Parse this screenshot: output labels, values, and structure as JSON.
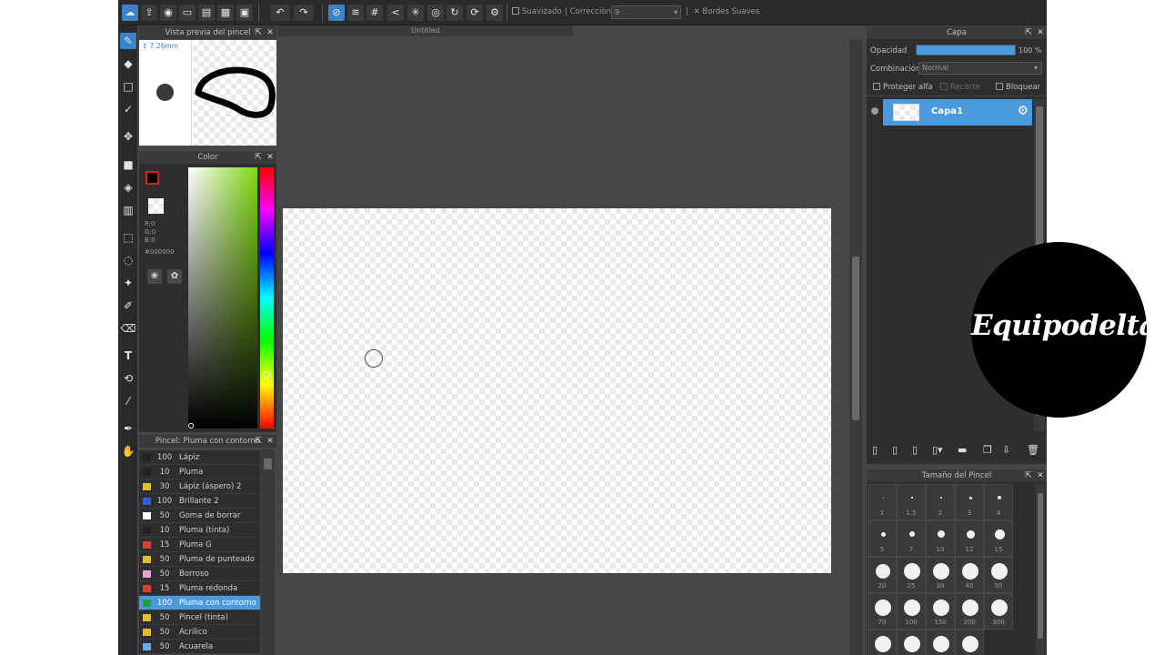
{
  "toolbar": {
    "suavizado_label": "Suavizado",
    "correccion_label": "Corrección",
    "correccion_value": "9",
    "bordes_label": "Bordes Suaves"
  },
  "canvas": {
    "tab_title": "Untitled"
  },
  "brush_preview": {
    "title": "Vista previa del pincel",
    "size": "7.26mm"
  },
  "color_panel": {
    "title": "Color",
    "r": "R:0",
    "g": "G:0",
    "b": "B:0",
    "hex": "#000000",
    "foreground": "#d91f11",
    "background": "#ffffff"
  },
  "brush_panel": {
    "title": "Pincel: Pluma con contorno",
    "items": [
      {
        "size": "100",
        "name": "Lápiz",
        "color": "#222222"
      },
      {
        "size": "10",
        "name": "Pluma",
        "color": "#222222"
      },
      {
        "size": "30",
        "name": "Lápiz (áspero) 2",
        "color": "#e0c020"
      },
      {
        "size": "100",
        "name": "Brillante 2",
        "color": "#2f5fe0"
      },
      {
        "size": "50",
        "name": "Goma de borrar",
        "color": "#ffffff"
      },
      {
        "size": "10",
        "name": "Pluma (tinta)",
        "color": "#222222"
      },
      {
        "size": "15",
        "name": "Pluma G",
        "color": "#e03c2c"
      },
      {
        "size": "50",
        "name": "Pluma de punteado",
        "color": "#e0c020"
      },
      {
        "size": "50",
        "name": "Borroso",
        "color": "#f0a0d0"
      },
      {
        "size": "15",
        "name": "Pluma redonda",
        "color": "#e03c2c"
      },
      {
        "size": "100",
        "name": "Pluma con contorno",
        "color": "#22a035",
        "selected": true
      },
      {
        "size": "50",
        "name": "Pincel (tinta)",
        "color": "#e0c020"
      },
      {
        "size": "50",
        "name": "Acrílico",
        "color": "#e0c020"
      },
      {
        "size": "50",
        "name": "Acuarela",
        "color": "#60b0f0"
      }
    ]
  },
  "layer_panel": {
    "title": "Capa",
    "opacity_label": "Opacidad",
    "opacity_value": "100 %",
    "opacity_fraction": 1.0,
    "blend_label": "Combinación",
    "blend_value": "Normal",
    "protect_alpha": "Proteger alfa",
    "clip": "Recorte",
    "lock": "Bloquear",
    "layers": [
      {
        "name": "Capa1"
      }
    ]
  },
  "brush_size_panel": {
    "title": "Tamaño del Pincel",
    "sizes": [
      "1",
      "1.5",
      "2",
      "3",
      "4",
      "5",
      "7",
      "10",
      "12",
      "15",
      "20",
      "25",
      "30",
      "40",
      "50",
      "70",
      "100",
      "150",
      "200",
      "300",
      "",
      "",
      "",
      ""
    ]
  },
  "logo": {
    "text": "Equipodelta"
  }
}
